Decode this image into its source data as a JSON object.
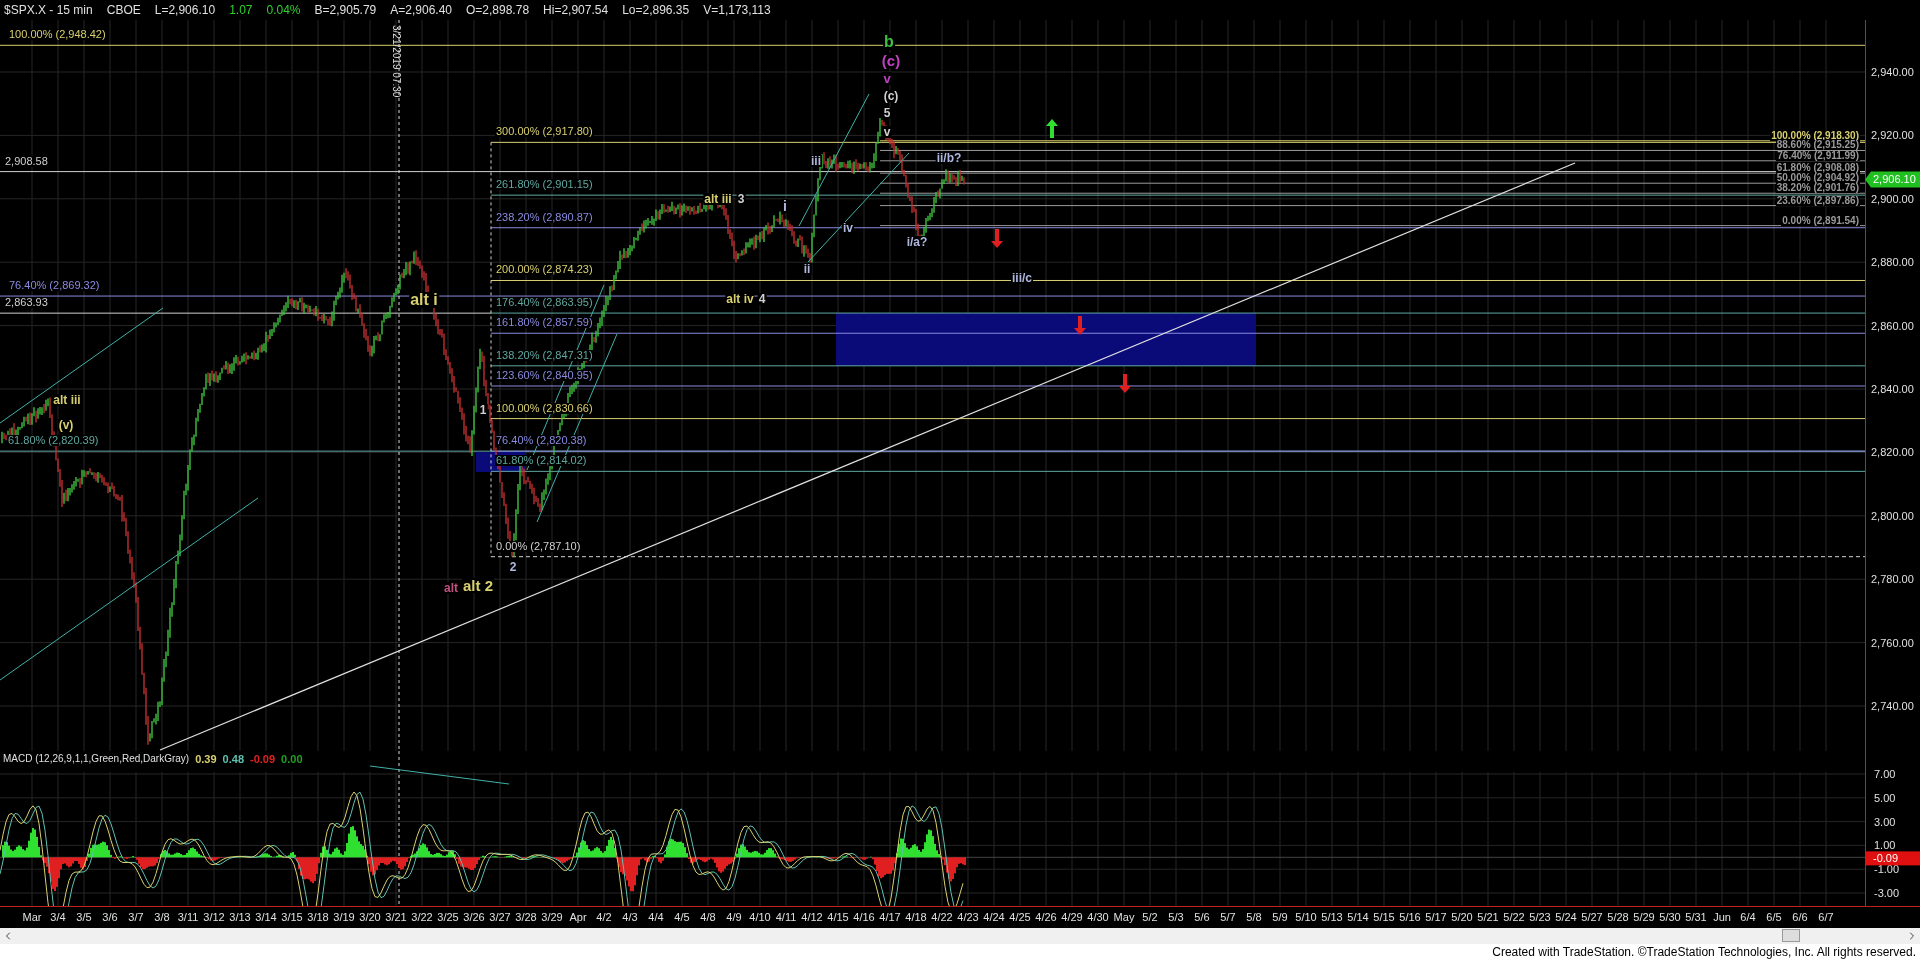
{
  "header": [
    {
      "text": "$SPX.X - 15 min",
      "kind": "symbol"
    },
    {
      "text": "CBOE",
      "kind": "symbol"
    },
    {
      "text": "L=2,906.10",
      "kind": "quote"
    },
    {
      "text": "1.07",
      "kind": "change"
    },
    {
      "text": "0.04%",
      "kind": "change"
    },
    {
      "text": "B=2,905.79",
      "kind": "quote"
    },
    {
      "text": "A=2,906.40",
      "kind": "quote"
    },
    {
      "text": "O=2,898.78",
      "kind": "quote"
    },
    {
      "text": "Hi=2,907.54",
      "kind": "quote"
    },
    {
      "text": "Lo=2,896.35",
      "kind": "quote"
    },
    {
      "text": "V=1,173,113",
      "kind": "quote"
    }
  ],
  "date_marker": "3/21/2019 07:30",
  "level_labels": [
    {
      "text": "100.00% (2,948.42)",
      "color": "#d8d070"
    },
    {
      "text": "2,908.58",
      "color": "#d0d0d0"
    },
    {
      "text": "76.40% (2,869.32)",
      "color": "#8a8ae0"
    },
    {
      "text": "2,863.93",
      "color": "#d0d0d0"
    },
    {
      "text": "61.80% (2,820.39)",
      "color": "#5fa8a0"
    }
  ],
  "fib_extension": [
    {
      "text": "300.00% (2,917.80)",
      "color": "#d8d070"
    },
    {
      "text": "261.80% (2,901.15)",
      "color": "#5fa8a0"
    },
    {
      "text": "238.20% (2,890.87)",
      "color": "#8a8ae0"
    },
    {
      "text": "200.00% (2,874.23)",
      "color": "#d8d070"
    },
    {
      "text": "176.40% (2,863.95)",
      "color": "#5fa8a0"
    },
    {
      "text": "161.80% (2,857.59)",
      "color": "#8a8ae0"
    },
    {
      "text": "138.20% (2,847.31)",
      "color": "#5fa8a0"
    },
    {
      "text": "123.60% (2,840.95)",
      "color": "#8a8ae0"
    },
    {
      "text": "100.00% (2,830.66)",
      "color": "#d8d070"
    },
    {
      "text": "76.40% (2,820.38)",
      "color": "#8a8ae0"
    },
    {
      "text": "61.80% (2,814.02)",
      "color": "#5fa8a0"
    },
    {
      "text": "0.00% (2,787.10)",
      "color": "#d0d0d0"
    }
  ],
  "fib_retracement": [
    {
      "text": "100.00% (2,918.30)",
      "color": "#d8d070"
    },
    {
      "text": "88.60% (2,915.25)",
      "color": "#9a9a9a"
    },
    {
      "text": "76.40% (2,911.99)",
      "color": "#9a9a9a"
    },
    {
      "text": "61.80% (2,908.08)",
      "color": "#9a9a9a"
    },
    {
      "text": "50.00% (2,904.92)",
      "color": "#9a9a9a"
    },
    {
      "text": "38.20% (2,901.76)",
      "color": "#9a9a9a"
    },
    {
      "text": "23.60% (2,897.86)",
      "color": "#9a9a9a"
    },
    {
      "text": "0.00% (2,891.54)",
      "color": "#9a9a9a"
    }
  ],
  "wave_labels": [
    {
      "text": "b",
      "color": "#40c040"
    },
    {
      "text": "(c)",
      "color": "#c040c0"
    },
    {
      "text": "v",
      "color": "#c040c0"
    },
    {
      "text": "(c)",
      "color": "#d0d0d0"
    },
    {
      "text": "5",
      "color": "#d0d0d0"
    },
    {
      "text": "v",
      "color": "#d0d0d0"
    },
    {
      "text": "iii",
      "color": "#b0b8e0"
    },
    {
      "text": "ii/b?",
      "color": "#b0b8e0"
    },
    {
      "text": "alt iii",
      "color": "#d8d070"
    },
    {
      "text": "3",
      "color": "#d0d0d0"
    },
    {
      "text": "i",
      "color": "#b0b8e0"
    },
    {
      "text": "iv",
      "color": "#b0b8e0"
    },
    {
      "text": "i/a?",
      "color": "#b0b8e0"
    },
    {
      "text": "ii",
      "color": "#b0b8e0"
    },
    {
      "text": "iii/c",
      "color": "#b0b8e0"
    },
    {
      "text": "alt i",
      "color": "#d8d070"
    },
    {
      "text": "alt iv",
      "color": "#d8d070"
    },
    {
      "text": "4",
      "color": "#d0d0d0"
    },
    {
      "text": "alt iii",
      "color": "#d8d070"
    },
    {
      "text": "1",
      "color": "#d0d0d0"
    },
    {
      "text": "(v)",
      "color": "#d8d070"
    },
    {
      "text": "2",
      "color": "#b0b8e0"
    },
    {
      "text": "alt",
      "color": "#c05080"
    },
    {
      "text": "alt 2",
      "color": "#d8d070"
    }
  ],
  "price_axis": [
    "2,940.00",
    "2,920.00",
    "2,900.00",
    "2,880.00",
    "2,860.00",
    "2,840.00",
    "2,820.00",
    "2,800.00",
    "2,780.00",
    "2,760.00",
    "2,740.00"
  ],
  "last_price": "2,906.10",
  "macd": {
    "title": "MACD (12,26,9,1,1,Green,Red,DarkGray)",
    "values": [
      {
        "text": "0.39",
        "color": "#d8d070"
      },
      {
        "text": "0.48",
        "color": "#5fc0b0"
      },
      {
        "text": "-0.09",
        "color": "#e02020"
      },
      {
        "text": "0.00",
        "color": "#20a020"
      }
    ],
    "axis": [
      "7.00",
      "5.00",
      "3.00",
      "1.00",
      "-1.00",
      "-3.00"
    ],
    "last_value": "-0.09"
  },
  "time_axis": [
    "Mar",
    "3/4",
    "3/5",
    "3/6",
    "3/7",
    "3/8",
    "3/11",
    "3/12",
    "3/13",
    "3/14",
    "3/15",
    "3/18",
    "3/19",
    "3/20",
    "3/21",
    "3/22",
    "3/25",
    "3/26",
    "3/27",
    "3/28",
    "3/29",
    "Apr",
    "4/2",
    "4/3",
    "4/4",
    "4/5",
    "4/8",
    "4/9",
    "4/10",
    "4/11",
    "4/12",
    "4/15",
    "4/16",
    "4/17",
    "4/18",
    "4/22",
    "4/23",
    "4/24",
    "4/25",
    "4/26",
    "4/29",
    "4/30",
    "May",
    "5/2",
    "5/3",
    "5/6",
    "5/7",
    "5/8",
    "5/9",
    "5/10",
    "5/13",
    "5/14",
    "5/15",
    "5/16",
    "5/17",
    "5/20",
    "5/21",
    "5/22",
    "5/23",
    "5/24",
    "5/27",
    "5/28",
    "5/29",
    "5/30",
    "5/31",
    "Jun",
    "6/4",
    "6/5",
    "6/6",
    "6/7"
  ],
  "footer": "Created with TradeStation. ©TradeStation Technologies, Inc. All rights reserved."
}
